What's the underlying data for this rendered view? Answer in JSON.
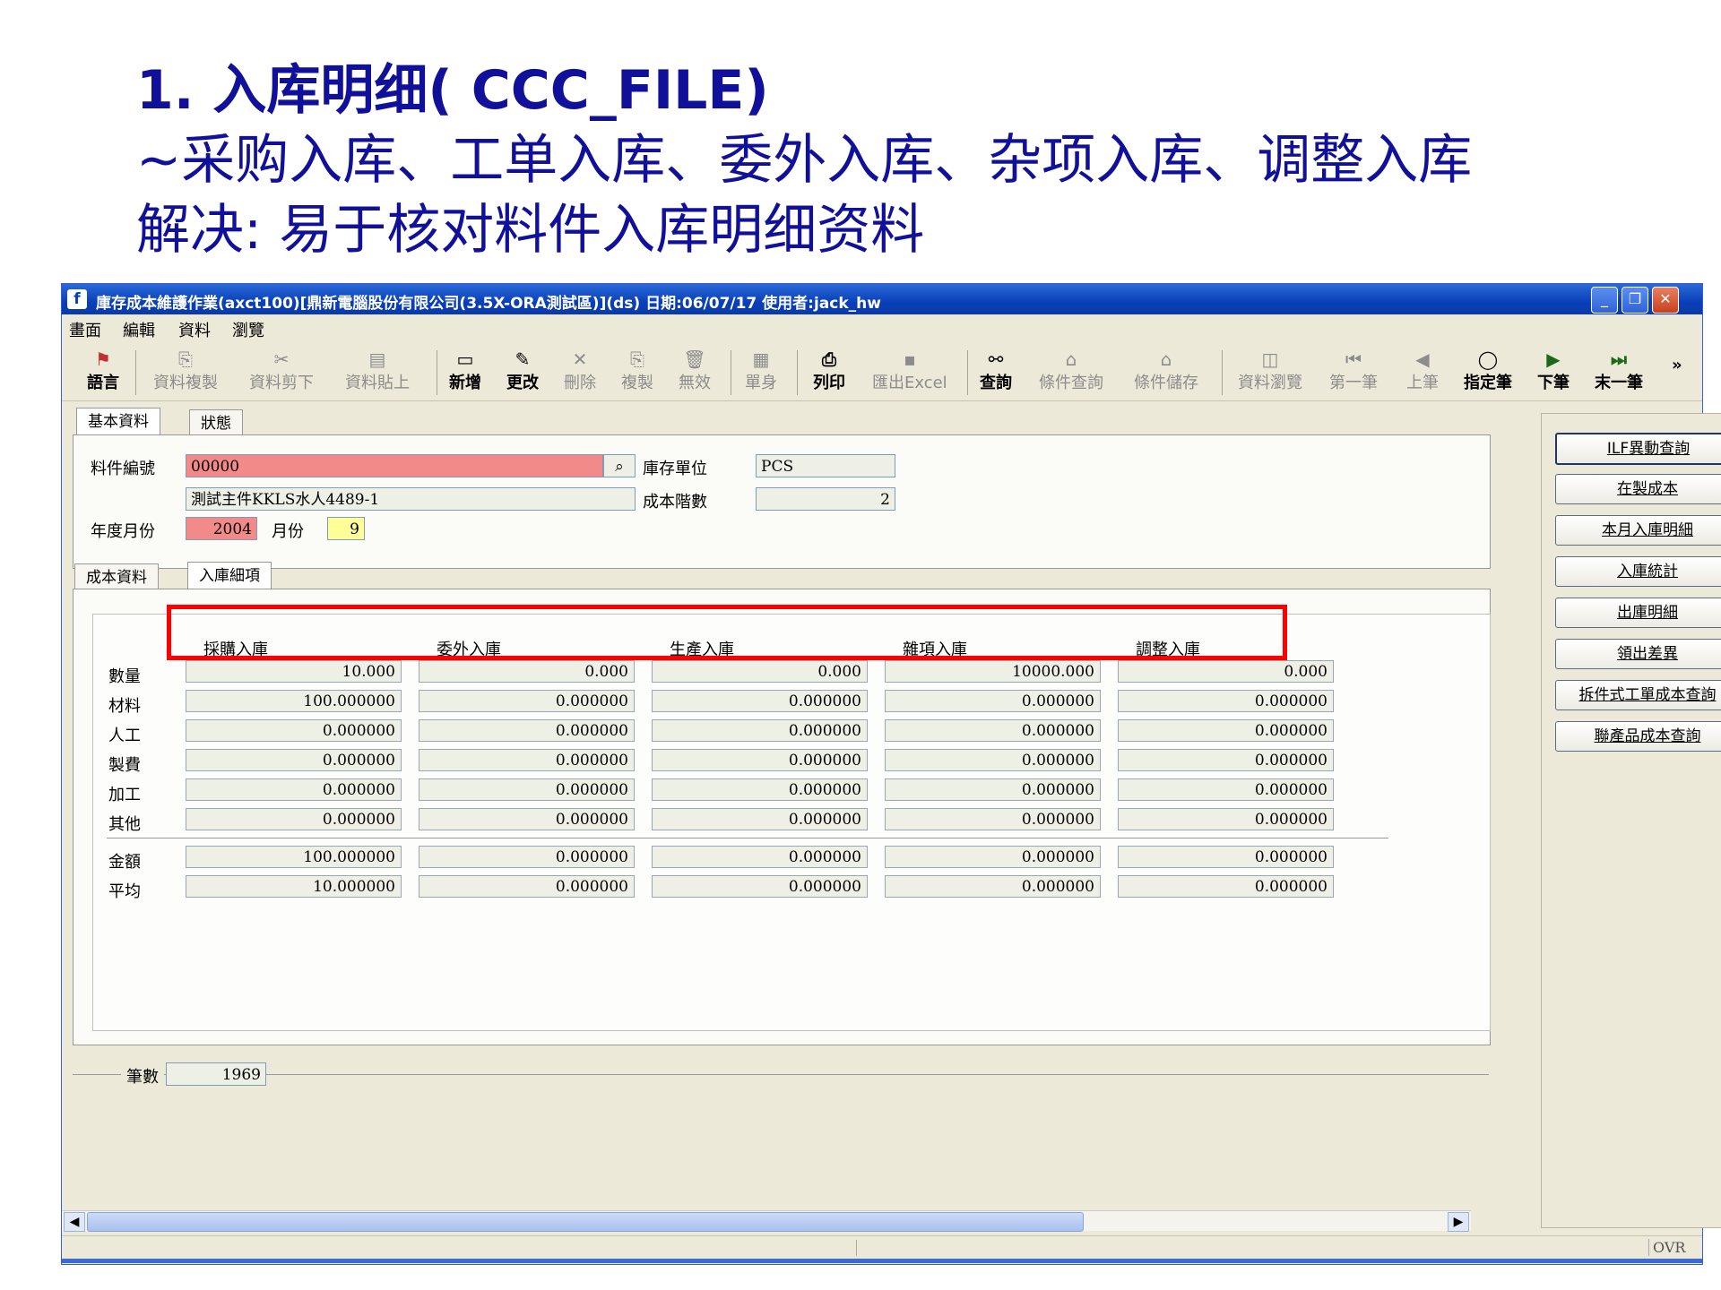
{
  "slide": {
    "line1": "1. 入库明细( CCC_FILE)",
    "line2": "~采购入库、工单入库、委外入库、杂项入库、调整入库",
    "line3": "解决: 易于核对料件入库明细资料"
  },
  "window": {
    "title": "庫存成本維護作業(axct100)[鼎新電腦股份有限公司(3.5X-ORA測試區)](ds)  日期:06/07/17   使用者:jack_hw",
    "controls": [
      "_",
      "❐",
      "✕"
    ]
  },
  "menu": [
    "畫面",
    "編輯",
    "資料",
    "瀏覽"
  ],
  "toolbar": [
    {
      "label": "語言",
      "icon": "flag-icon",
      "enabled": true
    },
    {
      "label": "資料複製",
      "icon": "copy-icon",
      "enabled": false
    },
    {
      "label": "資料剪下",
      "icon": "cut-icon",
      "enabled": false
    },
    {
      "label": "資料貼上",
      "icon": "paste-icon",
      "enabled": false
    },
    {
      "label": "新增",
      "icon": "new-icon",
      "enabled": true
    },
    {
      "label": "更改",
      "icon": "edit-icon",
      "enabled": true
    },
    {
      "label": "刪除",
      "icon": "delete-icon",
      "enabled": false
    },
    {
      "label": "複製",
      "icon": "duplicate-icon",
      "enabled": false
    },
    {
      "label": "無效",
      "icon": "trash-icon",
      "enabled": false
    },
    {
      "label": "單身",
      "icon": "detail-icon",
      "enabled": false
    },
    {
      "label": "列印",
      "icon": "print-icon",
      "enabled": true
    },
    {
      "label": "匯出Excel",
      "icon": "export-icon",
      "enabled": false
    },
    {
      "label": "查詢",
      "icon": "binoculars-icon",
      "enabled": true
    },
    {
      "label": "條件查詢",
      "icon": "filter-query-icon",
      "enabled": false
    },
    {
      "label": "條件儲存",
      "icon": "filter-save-icon",
      "enabled": false
    },
    {
      "label": "資料瀏覽",
      "icon": "browse-icon",
      "enabled": false
    },
    {
      "label": "第一筆",
      "icon": "first-icon",
      "enabled": false
    },
    {
      "label": "上筆",
      "icon": "prev-icon",
      "enabled": false
    },
    {
      "label": "指定筆",
      "icon": "speech-icon",
      "enabled": true
    },
    {
      "label": "下筆",
      "icon": "next-icon",
      "enabled": true
    },
    {
      "label": "末一筆",
      "icon": "last-icon",
      "enabled": true
    }
  ],
  "tabs_top": [
    "基本資料",
    "狀態"
  ],
  "form": {
    "item_no_label": "料件編號",
    "item_no": "00000",
    "item_desc": "測試主件KKLS水人4489-1",
    "unit_label": "庫存單位",
    "unit": "PCS",
    "cost_level_label": "成本階數",
    "cost_level": "2",
    "year_label": "年度月份",
    "year": "2004",
    "month_label": "月份",
    "month": "9"
  },
  "tabs_bottom": [
    "成本資料",
    "入庫細項"
  ],
  "grid": {
    "columns": [
      "採購入庫",
      "委外入庫",
      "生產入庫",
      "雜項入庫",
      "調整入庫"
    ],
    "rows": [
      {
        "label": "數量",
        "values": [
          "10.000",
          "0.000",
          "0.000",
          "10000.000",
          "0.000"
        ]
      },
      {
        "label": "材料",
        "values": [
          "100.000000",
          "0.000000",
          "0.000000",
          "0.000000",
          "0.000000"
        ]
      },
      {
        "label": "人工",
        "values": [
          "0.000000",
          "0.000000",
          "0.000000",
          "0.000000",
          "0.000000"
        ]
      },
      {
        "label": "製費",
        "values": [
          "0.000000",
          "0.000000",
          "0.000000",
          "0.000000",
          "0.000000"
        ]
      },
      {
        "label": "加工",
        "values": [
          "0.000000",
          "0.000000",
          "0.000000",
          "0.000000",
          "0.000000"
        ]
      },
      {
        "label": "其他",
        "values": [
          "0.000000",
          "0.000000",
          "0.000000",
          "0.000000",
          "0.000000"
        ]
      },
      {
        "label": "金額",
        "values": [
          "100.000000",
          "0.000000",
          "0.000000",
          "0.000000",
          "0.000000"
        ]
      },
      {
        "label": "平均",
        "values": [
          "10.000000",
          "0.000000",
          "0.000000",
          "0.000000",
          "0.000000"
        ]
      }
    ]
  },
  "record_count_label": "筆數",
  "record_count": "1969",
  "side_buttons": [
    "ILF異動查詢",
    "在製成本",
    "本月入庫明細",
    "入庫統計",
    "出庫明細",
    "領出差異",
    "拆件式工單成本查詢",
    "聯產品成本查詢"
  ],
  "status": "OVR"
}
